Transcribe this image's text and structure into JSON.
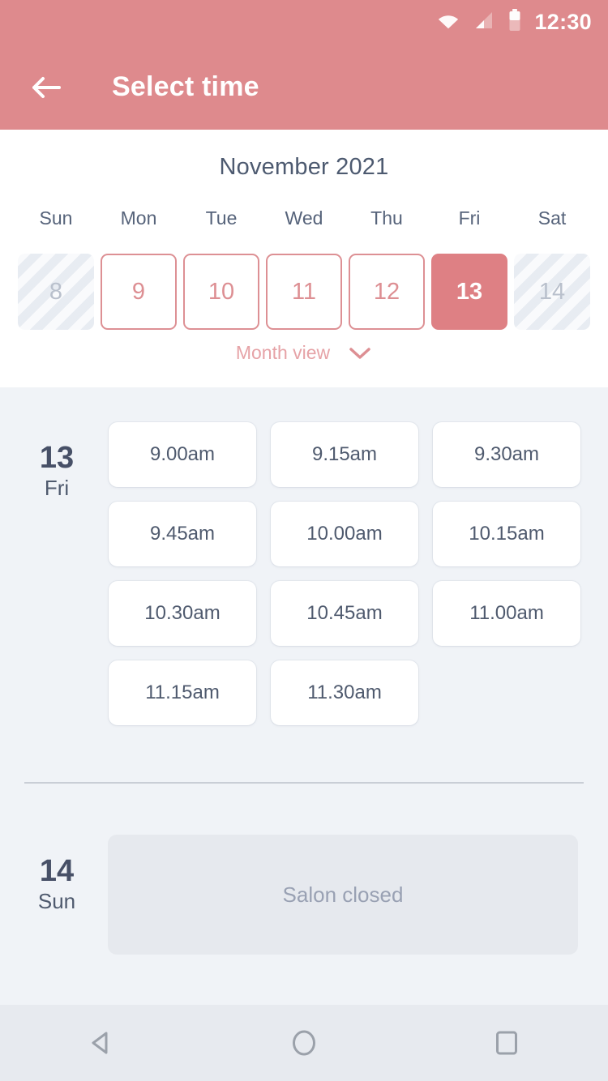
{
  "status_bar": {
    "clock": "12:30",
    "icons": [
      "wifi-icon",
      "cell-signal-icon",
      "battery-icon"
    ]
  },
  "app_bar": {
    "title": "Select time",
    "back_icon": "arrow-left-icon",
    "background_color": "#de8a8d"
  },
  "calendar": {
    "month_title": "November 2021",
    "weekdays": [
      "Sun",
      "Mon",
      "Tue",
      "Wed",
      "Thu",
      "Fri",
      "Sat"
    ],
    "days": [
      {
        "num": "8",
        "state": "disabled"
      },
      {
        "num": "9",
        "state": "available"
      },
      {
        "num": "10",
        "state": "available"
      },
      {
        "num": "11",
        "state": "available"
      },
      {
        "num": "12",
        "state": "available"
      },
      {
        "num": "13",
        "state": "selected"
      },
      {
        "num": "14",
        "state": "disabled"
      }
    ],
    "month_view_label": "Month view",
    "month_view_icon": "chevron-down-icon",
    "accent_color": "#de8084",
    "available_border_color": "#dd9094",
    "disabled_color": "#b9c0cc"
  },
  "slots": {
    "background_color": "#f0f3f7",
    "groups": [
      {
        "day_number": "13",
        "day_of_week": "Fri",
        "times": [
          "9.00am",
          "9.15am",
          "9.30am",
          "9.45am",
          "10.00am",
          "10.15am",
          "10.30am",
          "10.45am",
          "11.00am",
          "11.15am",
          "11.30am"
        ]
      },
      {
        "day_number": "14",
        "day_of_week": "Sun",
        "closed_message": "Salon closed"
      }
    ]
  },
  "nav_bar": {
    "buttons": [
      "back-triangle-icon",
      "home-circle-icon",
      "recents-square-icon"
    ],
    "background_color": "#e7eaef",
    "icon_color": "#9ba1aa"
  }
}
